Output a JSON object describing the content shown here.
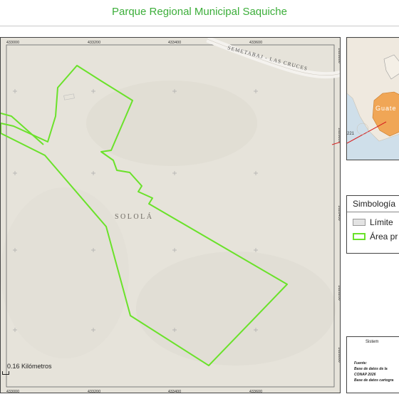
{
  "title": "Parque Regional Municipal Saquiche",
  "map": {
    "x_ticks": [
      "433000",
      "433200",
      "433400",
      "433600"
    ],
    "y_ticks": [
      "1628800",
      "1628600",
      "1628400",
      "1628200",
      "1628000"
    ],
    "place_label": "SOLOLÁ",
    "road_label": "SEMETABAJ - LAS CRUCES",
    "route_label": "221",
    "scale_label": "0.16 Kilómetros",
    "colors": {
      "boundary": "#6ae22a",
      "terrain": "#e6e3da",
      "road": "#f4f2ee"
    }
  },
  "inset": {
    "label": "Guate",
    "colors": {
      "highlight": "#f0a656",
      "sea": "#cfdfea",
      "land": "#efe9df",
      "line": "#d62020"
    }
  },
  "legend": {
    "title": "Simbología",
    "items": [
      {
        "label": "Límite",
        "color": "#9a9a9a",
        "fill": "#e3e3e3"
      },
      {
        "label": "Área pr",
        "color": "#6ae22a",
        "fill": "#ffffff"
      }
    ]
  },
  "sources": {
    "system": "Sistem",
    "lines": [
      "Fuente:",
      "Base de datos de la",
      "CONAP 2026",
      "Base de datos cartogra"
    ]
  }
}
